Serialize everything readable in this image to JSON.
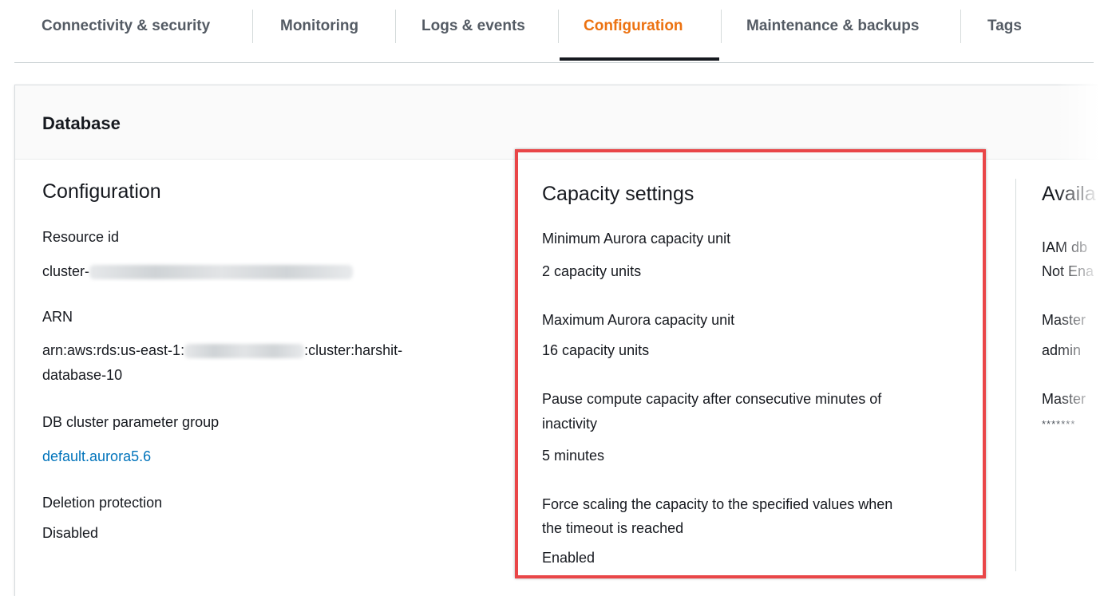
{
  "tabs": [
    {
      "label": "Connectivity & security"
    },
    {
      "label": "Monitoring"
    },
    {
      "label": "Logs & events"
    },
    {
      "label": "Configuration"
    },
    {
      "label": "Maintenance & backups"
    },
    {
      "label": "Tags"
    }
  ],
  "active_tab": "Configuration",
  "panel": {
    "title": "Database"
  },
  "configuration": {
    "title": "Configuration",
    "resource_id_label": "Resource id",
    "resource_id_prefix": "cluster-",
    "arn_label": "ARN",
    "arn_prefix": "arn:aws:rds:us-east-1:",
    "arn_suffix": ":cluster:harshit-",
    "arn_line2": "database-10",
    "param_group_label": "DB cluster parameter group",
    "param_group_value": "default.aurora5.6",
    "deletion_label": "Deletion protection",
    "deletion_value": "Disabled"
  },
  "capacity": {
    "title": "Capacity settings",
    "min_label": "Minimum Aurora capacity unit",
    "min_value": "2 capacity units",
    "max_label": "Maximum Aurora capacity unit",
    "max_value": "16 capacity units",
    "pause_label_line1": "Pause compute capacity after consecutive minutes of",
    "pause_label_line2": "inactivity",
    "pause_value": "5 minutes",
    "force_label_line1": "Force scaling the capacity to the specified values when",
    "force_label_line2": "the timeout is reached",
    "force_value": "Enabled"
  },
  "availability": {
    "title": "Availa",
    "iam_label": "IAM db",
    "iam_value": "Not Ena",
    "master_label": "Master",
    "master_value": "admin",
    "master2_label": "Master",
    "master2_value": "*******"
  },
  "colors": {
    "accent": "#ec7211",
    "link": "#0073bb",
    "highlight": "#e94648"
  }
}
